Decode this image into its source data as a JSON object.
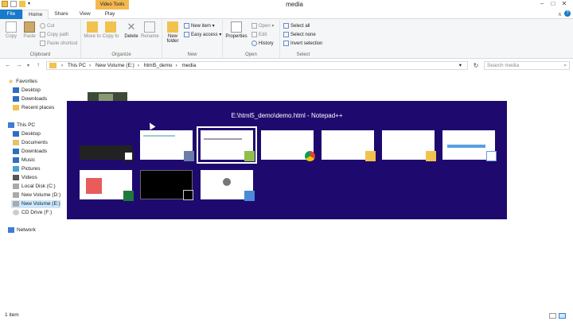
{
  "window": {
    "title": "media",
    "contextual_tab_title": "Video Tools"
  },
  "tabs": [
    "File",
    "Home",
    "Share",
    "View",
    "Play"
  ],
  "ribbon": {
    "clipboard": {
      "label": "Clipboard",
      "copy": "Copy",
      "paste": "Paste",
      "cut": "Cut",
      "copy_path": "Copy path",
      "paste_shortcut": "Paste shortcut"
    },
    "organize": {
      "label": "Organize",
      "move_to": "Move to",
      "copy_to": "Copy to",
      "delete": "Delete",
      "rename": "Rename"
    },
    "new": {
      "label": "New",
      "new_folder": "New folder",
      "new_item": "New item",
      "easy_access": "Easy access"
    },
    "open": {
      "label": "Open",
      "properties": "Properties",
      "open": "Open",
      "edit": "Edit",
      "history": "History"
    },
    "select": {
      "label": "Select",
      "select_all": "Select all",
      "select_none": "Select none",
      "invert_selection": "Invert selection"
    }
  },
  "address": {
    "crumbs": [
      "This PC",
      "New Volume (E:)",
      "html5_demo",
      "media"
    ],
    "search_placeholder": "Search media"
  },
  "nav_pane": {
    "favorites": "Favorites",
    "favorite_items": [
      "Desktop",
      "Downloads",
      "Recent places"
    ],
    "this_pc": "This PC",
    "pc_items": [
      "Desktop",
      "Documents",
      "Downloads",
      "Music",
      "Pictures",
      "Videos",
      "Local Disk (C:)",
      "New Volume (D:)",
      "New Volume (E:)",
      "CD Drive (F:)"
    ],
    "network": "Network"
  },
  "switcher": {
    "title": "E:\\html5_demo\\demo.html - Notepad++",
    "app_icons": [
      "camtasia-icon",
      "window-icon",
      "notepadpp-icon",
      "chrome-icon",
      "folder-icon",
      "folder-icon",
      "chart-icon",
      "excel-icon",
      "cmd-icon",
      "desktop-icon"
    ]
  },
  "status": {
    "item_count": "1 item"
  },
  "colors": {
    "file_tab": "#1979ca",
    "contextual_tab": "#f2b84f",
    "switcher_bg": "#1e0a6e",
    "nav_selected": "#cce8ff"
  }
}
